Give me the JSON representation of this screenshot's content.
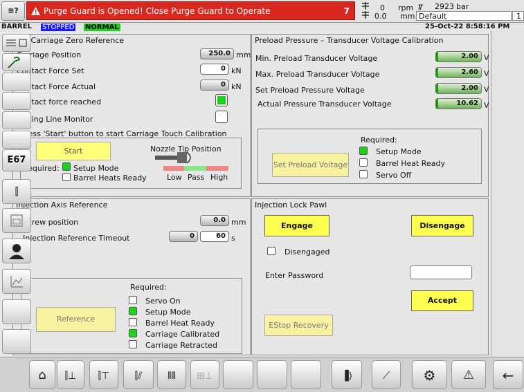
{
  "header": {
    "menu_label": "≡?",
    "alarm_text": "Purge Guard is Opened! Close Purge Guard to Operate",
    "alarm_count": "7",
    "rpm_value": "0",
    "rpm_unit": "rpm",
    "mm_value": "0.0",
    "mm_unit": "mm",
    "pressure_value": "2923",
    "pressure_unit": "bar",
    "profile": "Default",
    "profile_num": "1",
    "barrel_label": "BARREL",
    "stopped_label": "STOPPED",
    "normal_label": "NORMAL",
    "datetime": "25-Oct-22 8:58:16 PM"
  },
  "carriage": {
    "title": "Set Carriage Zero Reference",
    "position_label": "Carriage Position",
    "position_value": "250.0",
    "position_unit": "mm",
    "force_set_label": "Contact Force Set",
    "force_set_value": "0",
    "force_set_unit": "kN",
    "force_actual_label": "Contact Force Actual",
    "force_actual_value": "0",
    "force_actual_unit": "kN",
    "force_reached_label": "Contact force reached",
    "parting_label": "Parting Line Monitor",
    "instruction": "Press 'Start' button to start Carriage Touch Calibration",
    "start_label": "Start",
    "nozzle_label": "Nozzle Tip Position",
    "low_label": "Low",
    "pass_label": "Pass",
    "high_label": "High",
    "required_label": "Required:",
    "req_setup": "Setup Mode",
    "req_barrel": "Barrel Heats Ready"
  },
  "preload": {
    "title": "Preload Pressure – Transducer Voltage Calibration",
    "min_label": "Min. Preload Transducer Voltage",
    "min_value": "2.00",
    "max_label": "Max. Preload Transducer Voltage",
    "max_value": "2.60",
    "set_label": "Set Preload Pressure Voltage",
    "set_value": "2.00",
    "actual_label": "Actual Pressure Transducer Voltage",
    "actual_value": "10.62",
    "unit": "V",
    "button_label": "Set Preload Voltage",
    "required_label": "Required:",
    "req_setup": "Setup Mode",
    "req_barrel": "Barrel Heat Ready",
    "req_servo": "Servo Off"
  },
  "injection": {
    "title": "Injection Axis Reference",
    "screw_label": "Screw position",
    "screw_value": "0.0",
    "screw_unit": "mm",
    "timeout_label": "Injection Reference Timeout",
    "timeout_actual": "0",
    "timeout_set": "60",
    "timeout_unit": "s",
    "button_label": "Reference",
    "required_label": "Required:",
    "req_servo": "Servo On",
    "req_setup": "Setup Mode",
    "req_barrel": "Barrel Heat Ready",
    "req_calibrated": "Carriage Calibrated",
    "req_retracted": "Carriage Retracted"
  },
  "lockpawl": {
    "title": "Injection Lock Pawl",
    "engage_label": "Engage",
    "disengage_label": "Disengage",
    "disengaged_label": "Disengaged",
    "password_label": "Enter Password",
    "password_value": "",
    "accept_label": "Accept",
    "estop_label": "EStop Recovery"
  },
  "sidebar": {
    "e67_label": "E67"
  },
  "colors": {
    "alarm": "#d9281f",
    "stopped": "#1a1aff",
    "normal": "#18d020",
    "button_yellow": "#ffff50",
    "indicator_green": "#19d419"
  }
}
